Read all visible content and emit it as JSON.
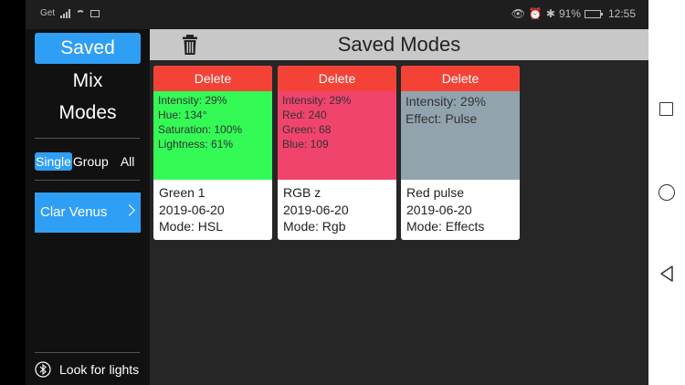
{
  "status_bar": {
    "carrier": "Get",
    "battery_pct": "91%",
    "time": "12:55",
    "battery_level": 0.91
  },
  "sidebar": {
    "nav": [
      {
        "label": "Saved",
        "active": true
      },
      {
        "label": "Mix",
        "active": false
      },
      {
        "label": "Modes",
        "active": false
      }
    ],
    "filters": [
      {
        "label": "Single",
        "active": true
      },
      {
        "label": "Group",
        "active": false
      },
      {
        "label": "All",
        "active": false
      }
    ],
    "device": {
      "label": "Clar Venus"
    },
    "look_for_lights": "Look for lights"
  },
  "main": {
    "title": "Saved Modes",
    "cards": [
      {
        "delete_label": "Delete",
        "color": "#33fa55",
        "details": [
          "Intensity: 29%",
          "Hue: 134°",
          "Saturation: 100%",
          "Lightness: 61%"
        ],
        "name": "Green 1",
        "date": "2019-06-20",
        "mode": "Mode: HSL"
      },
      {
        "delete_label": "Delete",
        "color": "#f0446d",
        "details": [
          "Intensity: 29%",
          "Red: 240",
          "Green: 68",
          "Blue: 109"
        ],
        "name": "RGB z",
        "date": "2019-06-20",
        "mode": "Mode: Rgb"
      },
      {
        "delete_label": "Delete",
        "color": "#91a4ad",
        "details": [
          "Intensity: 29%",
          "Effect: Pulse"
        ],
        "name": "Red pulse",
        "date": "2019-06-20",
        "mode": "Mode: Effects"
      }
    ]
  },
  "colors": {
    "accent": "#2f9ff5",
    "delete": "#f44336",
    "header": "#c8c8c8"
  }
}
